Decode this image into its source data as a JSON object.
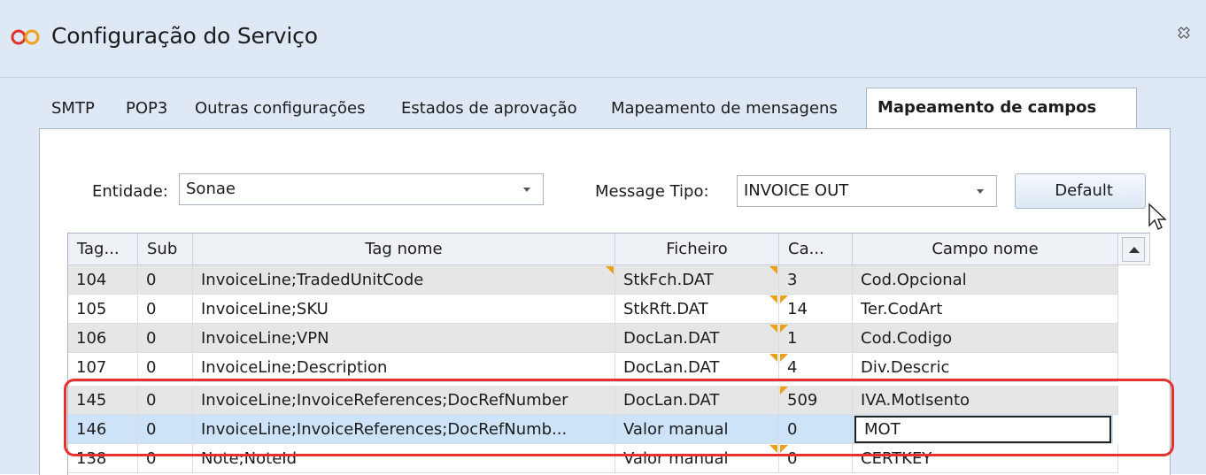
{
  "window": {
    "title": "Configuração do Serviço",
    "logo_icon": "infinity-logo",
    "close_icon": "close-icon"
  },
  "tabs": [
    {
      "label": "SMTP",
      "active": false
    },
    {
      "label": "POP3",
      "active": false
    },
    {
      "label": "Outras configurações",
      "active": false
    },
    {
      "label": "Estados de aprovação",
      "active": false
    },
    {
      "label": "Mapeamento de mensagens",
      "active": false
    },
    {
      "label": "Mapeamento de campos",
      "active": true
    }
  ],
  "form": {
    "entity_label": "Entidade:",
    "entity_value": "Sonae",
    "message_type_label": "Message Tipo:",
    "message_type_value": "INVOICE OUT",
    "default_button": "Default"
  },
  "grid": {
    "columns": [
      "Tag...",
      "Sub",
      "Tag nome",
      "Ficheiro",
      "Ca...",
      "Campo nome"
    ],
    "rows": [
      {
        "tag": "104",
        "sub": "0",
        "tag_nome": "InvoiceLine;TradedUnitCode",
        "ficheiro": "StkFch.DAT",
        "ca": "3",
        "campo_nome": "Cod.Opcional"
      },
      {
        "tag": "105",
        "sub": "0",
        "tag_nome": "InvoiceLine;SKU",
        "ficheiro": "StkRft.DAT",
        "ca": "14",
        "campo_nome": "Ter.CodArt"
      },
      {
        "tag": "106",
        "sub": "0",
        "tag_nome": "InvoiceLine;VPN",
        "ficheiro": "DocLan.DAT",
        "ca": "1",
        "campo_nome": "Cod.Codigo"
      },
      {
        "tag": "107",
        "sub": "0",
        "tag_nome": "InvoiceLine;Description",
        "ficheiro": "DocLan.DAT",
        "ca": "4",
        "campo_nome": "Div.Descric"
      },
      {
        "tag": "145",
        "sub": "0",
        "tag_nome": "InvoiceLine;InvoiceReferences;DocRefNumber",
        "ficheiro": "DocLan.DAT",
        "ca": "509",
        "campo_nome": "IVA.MotIsento"
      },
      {
        "tag": "146",
        "sub": "0",
        "tag_nome": "InvoiceLine;InvoiceReferences;DocRefNumb...",
        "ficheiro": "Valor manual",
        "ca": "0",
        "campo_nome": "MOT"
      },
      {
        "tag": "138",
        "sub": "0",
        "tag_nome": "Note;NoteId",
        "ficheiro": "Valor manual",
        "ca": "0",
        "campo_nome": "CERTKEY"
      }
    ]
  },
  "colors": {
    "chrome": "#dfe8f5",
    "selected_row": "#cde3f7",
    "alt_row": "#e6e6e6",
    "highlight": "#e8302f",
    "marker": "#e7a21a"
  }
}
